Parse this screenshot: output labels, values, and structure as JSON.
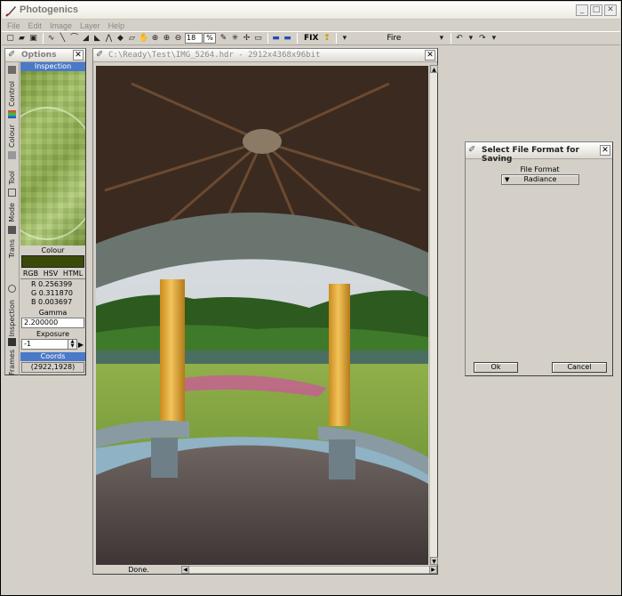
{
  "app": {
    "title": "Photogenics",
    "window_buttons": [
      "_",
      "□",
      "✕"
    ]
  },
  "menu": [
    "File",
    "Edit",
    "Image",
    "Layer",
    "Help"
  ],
  "toolbar": {
    "zoom_value": "18",
    "zoom_unit": "%",
    "fix_label": "FIX",
    "preset": "Fire"
  },
  "options_panel": {
    "title": "Options",
    "tabs": [
      "Control",
      "Colour",
      "Tool",
      "Mode",
      "Trans",
      "Inspection",
      "Frames"
    ],
    "inspection_header": "Inspection",
    "colour_label": "Colour",
    "colour_swatch": "#3c4a08",
    "color_modes": [
      "RGB",
      "HSV",
      "HTML"
    ],
    "rgb": {
      "r": "R 0.256399",
      "g": "G 0.311870",
      "b": "B 0.003697"
    },
    "gamma_label": "Gamma",
    "gamma_value": "2.200000",
    "exposure_label": "Exposure",
    "exposure_value": "-1",
    "coords_header": "Coords",
    "coords_value": "(2922,1928)"
  },
  "image_window": {
    "title": "C:\\Ready\\Test\\IMG_5264.hdr - 2912x4368x96bit",
    "status": "Done."
  },
  "save_dialog": {
    "title": "Select File Format for Saving",
    "format_label": "File Format",
    "format_value": "Radiance",
    "ok_label": "Ok",
    "cancel_label": "Cancel"
  }
}
